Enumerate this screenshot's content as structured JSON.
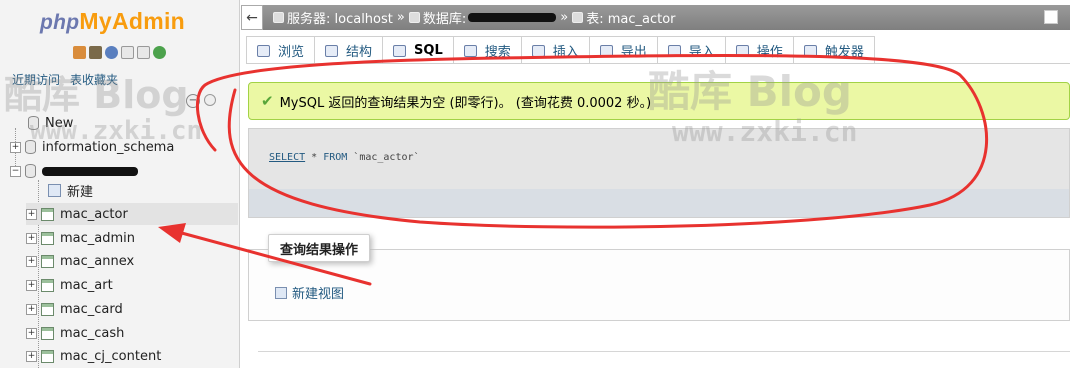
{
  "app": {
    "logo_php": "php",
    "logo_myadmin": "MyAdmin"
  },
  "nav": {
    "tabs": [
      "近期访问",
      "表收藏夹"
    ],
    "tree": [
      {
        "label": "New",
        "kind": "new-root"
      },
      {
        "label": "information_schema",
        "kind": "database"
      },
      {
        "label": "",
        "kind": "database-redacted"
      },
      {
        "label": "新建",
        "kind": "new-table"
      },
      {
        "label": "mac_actor",
        "kind": "table",
        "selected": true
      },
      {
        "label": "mac_admin",
        "kind": "table"
      },
      {
        "label": "mac_annex",
        "kind": "table"
      },
      {
        "label": "mac_art",
        "kind": "table"
      },
      {
        "label": "mac_card",
        "kind": "table"
      },
      {
        "label": "mac_cash",
        "kind": "table"
      },
      {
        "label": "mac_cj_content",
        "kind": "table"
      }
    ]
  },
  "breadcrumb": {
    "server": "服务器: localhost",
    "database": "数据库:",
    "table": "表: mac_actor",
    "sep": "»"
  },
  "tabs": [
    {
      "label": "浏览",
      "icon": "browse-icon"
    },
    {
      "label": "结构",
      "icon": "structure-icon"
    },
    {
      "label": "SQL",
      "icon": "sql-icon"
    },
    {
      "label": "搜索",
      "icon": "search-icon"
    },
    {
      "label": "插入",
      "icon": "insert-icon"
    },
    {
      "label": "导出",
      "icon": "export-icon"
    },
    {
      "label": "导入",
      "icon": "import-icon"
    },
    {
      "label": "操作",
      "icon": "wrench-icon"
    },
    {
      "label": "触发器",
      "icon": "triggers-icon"
    }
  ],
  "notice": {
    "text": "MySQL 返回的查询结果为空 (即零行)。 (查询花费 0.0002 秒。)"
  },
  "sql": {
    "select": "SELECT",
    "star": " * ",
    "from": "FROM",
    "table": " `mac_actor`"
  },
  "ops": {
    "legend": "查询结果操作",
    "create_view": "新建视图"
  },
  "watermark": {
    "blog": "酷库 Blog",
    "url": "www.zxki.cn"
  },
  "colors": {
    "notice_bg": "#ebf8a4",
    "annotation_red": "#e8322f",
    "link": "#235a81"
  }
}
